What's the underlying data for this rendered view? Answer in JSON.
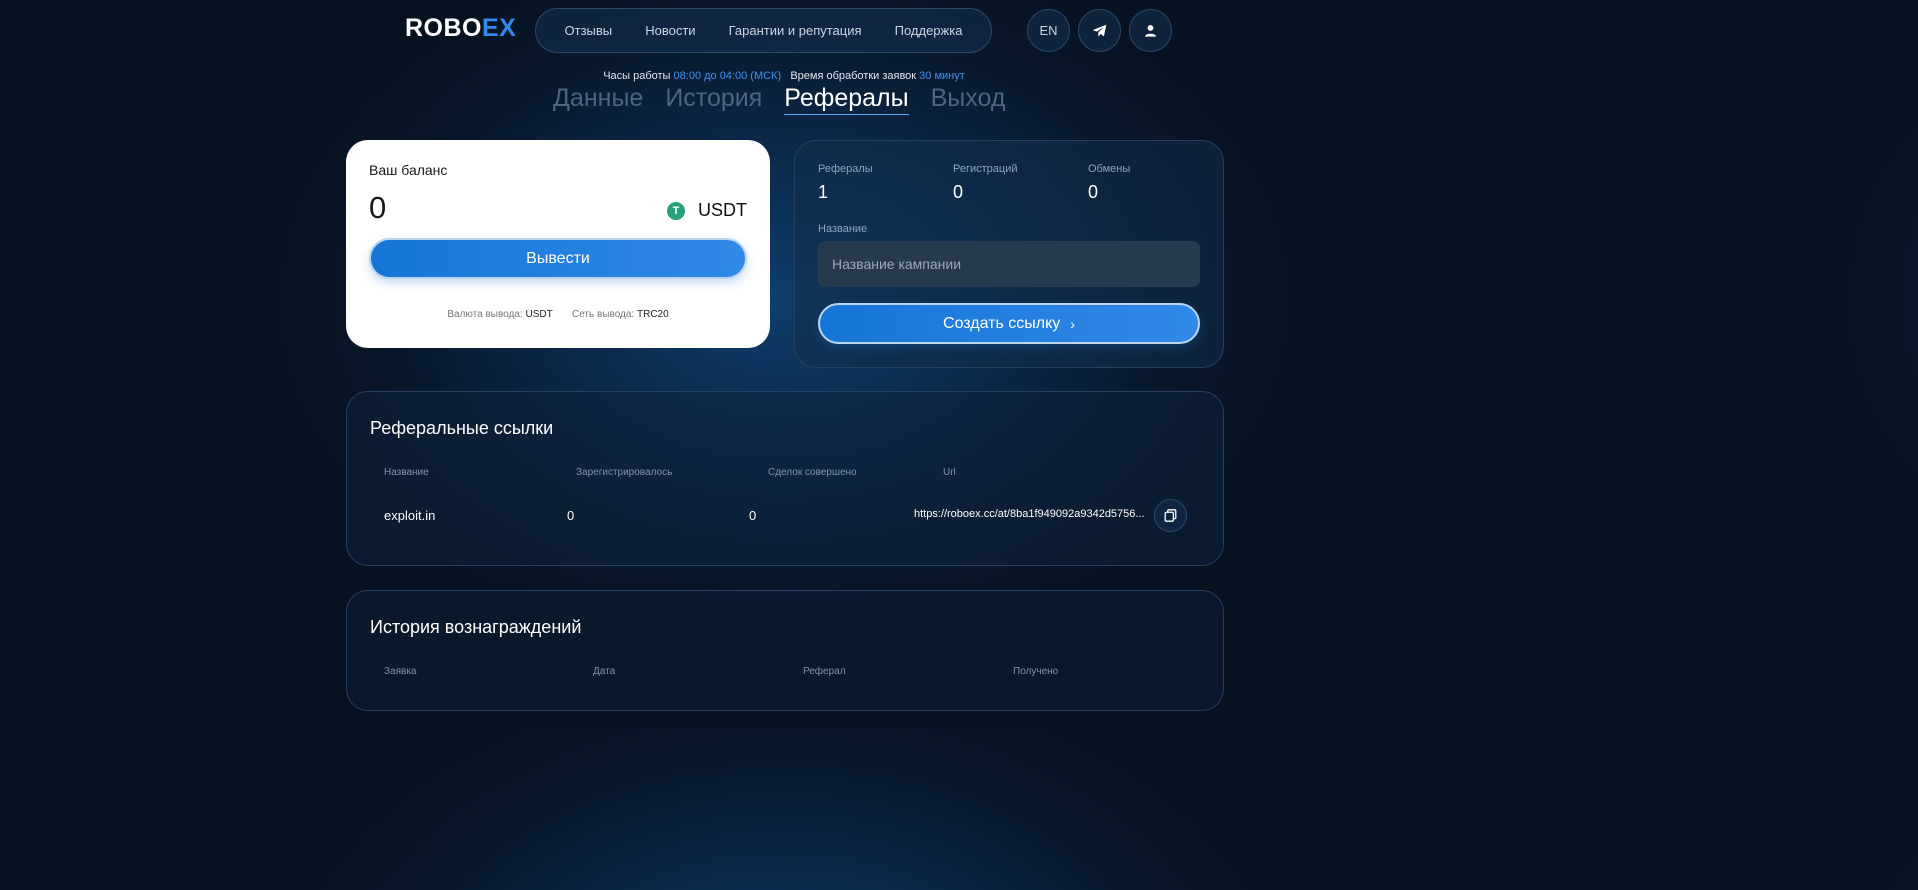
{
  "header": {
    "logo_main": "ROBO",
    "logo_accent": "EX",
    "nav": [
      "Отзывы",
      "Новости",
      "Гарантии и репутация",
      "Поддержка"
    ],
    "lang": "EN"
  },
  "hours": {
    "label1": "Часы работы",
    "value1": "08:00 до 04:00 (МСК)",
    "label2": "Время обработки заявок",
    "value2": "30 минут"
  },
  "tabs": [
    "Данные",
    "История",
    "Рефералы",
    "Выход"
  ],
  "balance": {
    "title": "Ваш баланс",
    "amount": "0",
    "currency_icon": "T",
    "currency": "USDT",
    "withdraw_label": "Вывести",
    "out_currency_label": "Валюта вывода:",
    "out_currency_value": "USDT",
    "out_network_label": "Сеть вывода:",
    "out_network_value": "TRC20"
  },
  "stats": {
    "referrals_label": "Рефералы",
    "referrals_value": "1",
    "registrations_label": "Регистраций",
    "registrations_value": "0",
    "exchanges_label": "Обмены",
    "exchanges_value": "0",
    "name_label": "Название",
    "name_placeholder": "Название кампании",
    "create_label": "Создать ссылку",
    "create_chevron": "›"
  },
  "links": {
    "title": "Реферальные ссылки",
    "columns": [
      "Название",
      "Зарегистрировалось",
      "Сделок совершено",
      "Url"
    ],
    "rows": [
      {
        "name": "exploit.in",
        "registered": "0",
        "deals": "0",
        "url": "https://roboex.cc/at/8ba1f949092a9342d5756..."
      }
    ]
  },
  "rewards": {
    "title": "История вознаграждений",
    "columns": [
      "Заявка",
      "Дата",
      "Реферал",
      "Получено"
    ]
  }
}
